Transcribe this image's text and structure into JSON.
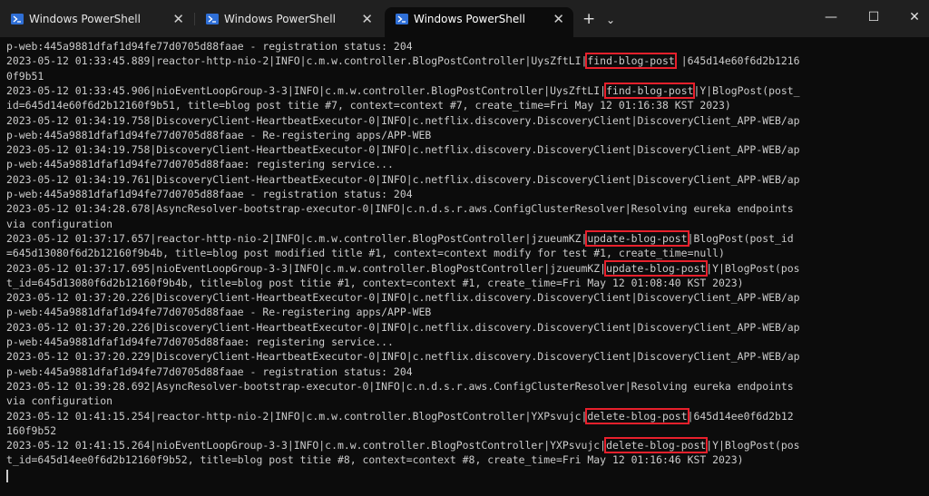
{
  "tabs": [
    {
      "label": "Windows PowerShell",
      "active": false
    },
    {
      "label": "Windows PowerShell",
      "active": false
    },
    {
      "label": "Windows PowerShell",
      "active": true
    }
  ],
  "titlebar": {
    "new_tab": "+",
    "dropdown": "⌄",
    "close_tab": "✕",
    "minimize": "—",
    "maximize": "☐",
    "close_window": "✕"
  },
  "colors": {
    "highlight": "#e8202c",
    "terminal_bg": "#0c0c0c",
    "text": "#cccccc",
    "titlebar_bg": "#202020"
  },
  "icons": {
    "tab_icon": "powershell-icon"
  },
  "lines": [
    {
      "pre": "p-web:445a9881dfaf1d94fe77d0705d88faae - registration status: 204",
      "hl": "",
      "post": ""
    },
    {
      "pre": "2023-05-12 01:33:45.889|reactor-http-nio-2|INFO|c.m.w.controller.BlogPostController|UysZftLI|",
      "hl": "find-blog-post",
      "post": " |645d14e60f6d2b1216"
    },
    {
      "pre": "0f9b51",
      "hl": "",
      "post": ""
    },
    {
      "pre": "2023-05-12 01:33:45.906|nioEventLoopGroup-3-3|INFO|c.m.w.controller.BlogPostController|UysZftLI|",
      "hl": "find-blog-post",
      "post": "|Y|BlogPost(post_"
    },
    {
      "pre": "id=645d14e60f6d2b12160f9b51, title=blog post titie #7, context=context #7, create_time=Fri May 12 01:16:38 KST 2023)",
      "hl": "",
      "post": ""
    },
    {
      "pre": "2023-05-12 01:34:19.758|DiscoveryClient-HeartbeatExecutor-0|INFO|c.netflix.discovery.DiscoveryClient|DiscoveryClient_APP-WEB/ap",
      "hl": "",
      "post": ""
    },
    {
      "pre": "p-web:445a9881dfaf1d94fe77d0705d88faae - Re-registering apps/APP-WEB",
      "hl": "",
      "post": ""
    },
    {
      "pre": "2023-05-12 01:34:19.758|DiscoveryClient-HeartbeatExecutor-0|INFO|c.netflix.discovery.DiscoveryClient|DiscoveryClient_APP-WEB/ap",
      "hl": "",
      "post": ""
    },
    {
      "pre": "p-web:445a9881dfaf1d94fe77d0705d88faae: registering service...",
      "hl": "",
      "post": ""
    },
    {
      "pre": "2023-05-12 01:34:19.761|DiscoveryClient-HeartbeatExecutor-0|INFO|c.netflix.discovery.DiscoveryClient|DiscoveryClient_APP-WEB/ap",
      "hl": "",
      "post": ""
    },
    {
      "pre": "p-web:445a9881dfaf1d94fe77d0705d88faae - registration status: 204",
      "hl": "",
      "post": ""
    },
    {
      "pre": "2023-05-12 01:34:28.678|AsyncResolver-bootstrap-executor-0|INFO|c.n.d.s.r.aws.ConfigClusterResolver|Resolving eureka endpoints",
      "hl": "",
      "post": ""
    },
    {
      "pre": "via configuration",
      "hl": "",
      "post": ""
    },
    {
      "pre": "2023-05-12 01:37:17.657|reactor-http-nio-2|INFO|c.m.w.controller.BlogPostController|jzueumKZ|",
      "hl": "update-blog-post",
      "post": "|BlogPost(post_id"
    },
    {
      "pre": "=645d13080f6d2b12160f9b4b, title=blog post modified title #1, context=context modify for test #1, create_time=null)",
      "hl": "",
      "post": ""
    },
    {
      "pre": "2023-05-12 01:37:17.695|nioEventLoopGroup-3-3|INFO|c.m.w.controller.BlogPostController|jzueumKZ|",
      "hl": "update-blog-post",
      "post": "|Y|BlogPost(pos"
    },
    {
      "pre": "t_id=645d13080f6d2b12160f9b4b, title=blog post titie #1, context=context #1, create_time=Fri May 12 01:08:40 KST 2023)",
      "hl": "",
      "post": ""
    },
    {
      "pre": "2023-05-12 01:37:20.226|DiscoveryClient-HeartbeatExecutor-0|INFO|c.netflix.discovery.DiscoveryClient|DiscoveryClient_APP-WEB/ap",
      "hl": "",
      "post": ""
    },
    {
      "pre": "p-web:445a9881dfaf1d94fe77d0705d88faae - Re-registering apps/APP-WEB",
      "hl": "",
      "post": ""
    },
    {
      "pre": "2023-05-12 01:37:20.226|DiscoveryClient-HeartbeatExecutor-0|INFO|c.netflix.discovery.DiscoveryClient|DiscoveryClient_APP-WEB/ap",
      "hl": "",
      "post": ""
    },
    {
      "pre": "p-web:445a9881dfaf1d94fe77d0705d88faae: registering service...",
      "hl": "",
      "post": ""
    },
    {
      "pre": "2023-05-12 01:37:20.229|DiscoveryClient-HeartbeatExecutor-0|INFO|c.netflix.discovery.DiscoveryClient|DiscoveryClient_APP-WEB/ap",
      "hl": "",
      "post": ""
    },
    {
      "pre": "p-web:445a9881dfaf1d94fe77d0705d88faae - registration status: 204",
      "hl": "",
      "post": ""
    },
    {
      "pre": "2023-05-12 01:39:28.692|AsyncResolver-bootstrap-executor-0|INFO|c.n.d.s.r.aws.ConfigClusterResolver|Resolving eureka endpoints",
      "hl": "",
      "post": ""
    },
    {
      "pre": "via configuration",
      "hl": "",
      "post": ""
    },
    {
      "pre": "2023-05-12 01:41:15.254|reactor-http-nio-2|INFO|c.m.w.controller.BlogPostController|YXPsvujc|",
      "hl": "delete-blog-post",
      "post": "|645d14ee0f6d2b12"
    },
    {
      "pre": "160f9b52",
      "hl": "",
      "post": ""
    },
    {
      "pre": "2023-05-12 01:41:15.264|nioEventLoopGroup-3-3|INFO|c.m.w.controller.BlogPostController|YXPsvujc|",
      "hl": "delete-blog-post",
      "post": "|Y|BlogPost(pos"
    },
    {
      "pre": "t_id=645d14ee0f6d2b12160f9b52, title=blog post titie #8, context=context #8, create_time=Fri May 12 01:16:46 KST 2023)",
      "hl": "",
      "post": ""
    }
  ]
}
